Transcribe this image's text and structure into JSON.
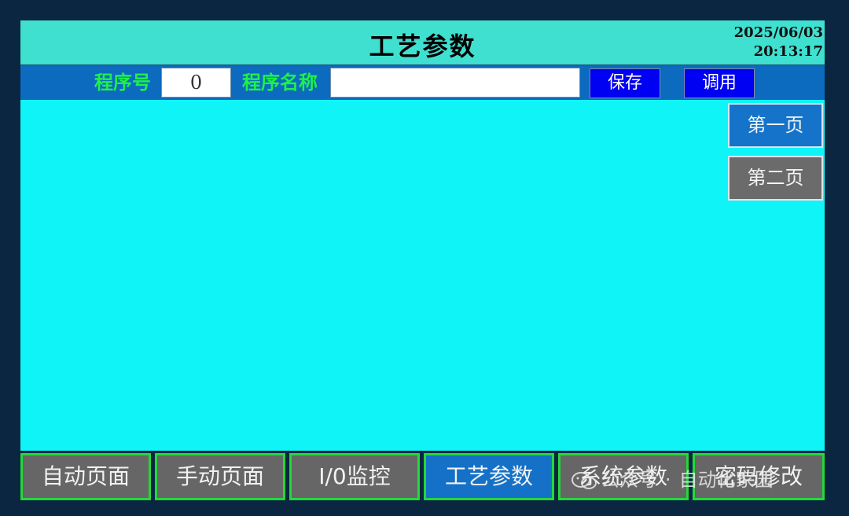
{
  "header": {
    "title": "工艺参数",
    "date": "2025/06/03",
    "time": "20:13:17"
  },
  "program_bar": {
    "program_no_label": "程序号",
    "program_no_value": "0",
    "program_name_label": "程序名称",
    "program_name_value": "",
    "save_label": "保存",
    "recall_label": "调用"
  },
  "page_buttons": {
    "page1": "第一页",
    "page2": "第二页"
  },
  "nav": {
    "items": [
      {
        "label": "自动页面"
      },
      {
        "label": "手动页面"
      },
      {
        "label": "I/0监控"
      },
      {
        "label": "工艺参数",
        "active": true
      },
      {
        "label": "系统参数"
      },
      {
        "label": "密码修改"
      }
    ]
  },
  "watermark": {
    "left": "公众号",
    "right": "自动化家园"
  },
  "colors": {
    "header_bg": "#3fe0d0",
    "program_bar_bg": "#0c6bbf",
    "content_bg": "#0ff5f7",
    "label_green": "#1ef04a",
    "button_blue": "#0000f2",
    "active_blue": "#1571c8",
    "inactive_gray": "#666666",
    "nav_border_green": "#24d83a"
  }
}
